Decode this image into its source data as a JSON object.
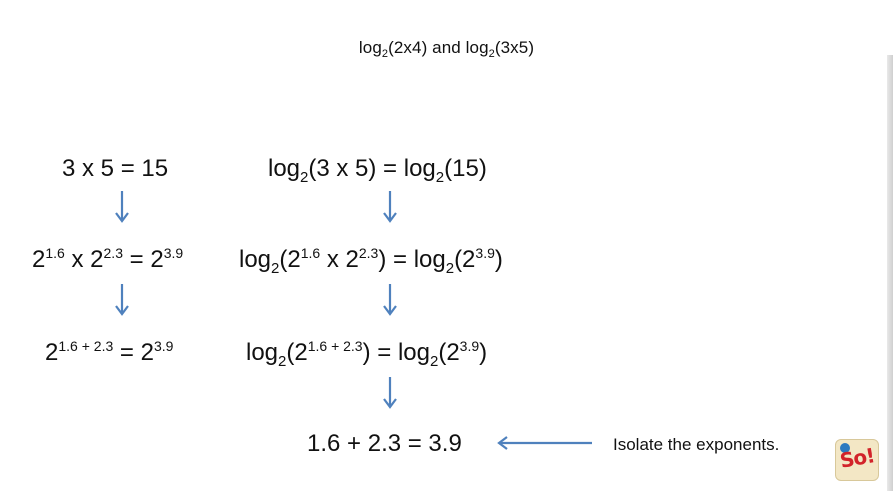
{
  "title": {
    "a_pre": "log",
    "a_sub": "2",
    "a_post": "(2x4) and log",
    "b_sub": "2",
    "b_post": "(3x5)"
  },
  "left": {
    "row1": "3 x 5 = 15",
    "row2": {
      "b1": "2",
      "e1": "1.6",
      "mid": " x 2",
      "e2": "2.3",
      "eq": " = 2",
      "e3": "3.9"
    },
    "row3": {
      "b1": "2",
      "e1": "1.6 + 2.3",
      "eq": " = 2",
      "e2": "3.9"
    }
  },
  "right": {
    "row1": {
      "p1": "log",
      "s1": "2",
      "m1": "(3 x 5) = log",
      "s2": "2",
      "m2": "(15)"
    },
    "row2": {
      "p1": "log",
      "s1": "2",
      "m1": "(2",
      "e1": "1.6",
      "m2": " x 2",
      "e2": "2.3",
      "m3": ") = log",
      "s2": "2",
      "m4": "(2",
      "e3": "3.9",
      "m5": ")"
    },
    "row3": {
      "p1": "log",
      "s1": "2",
      "m1": "(2",
      "e1": "1.6 + 2.3",
      "m2": ") = log",
      "s2": "2",
      "m3": "(2",
      "e2": "3.9",
      "m4": ")"
    },
    "row4": "1.6 + 2.3 = 3.9"
  },
  "note": "Isolate the exponents.",
  "logo": {
    "text": "So!"
  },
  "colors": {
    "arrow": "#4f81bd",
    "text": "#111111"
  }
}
